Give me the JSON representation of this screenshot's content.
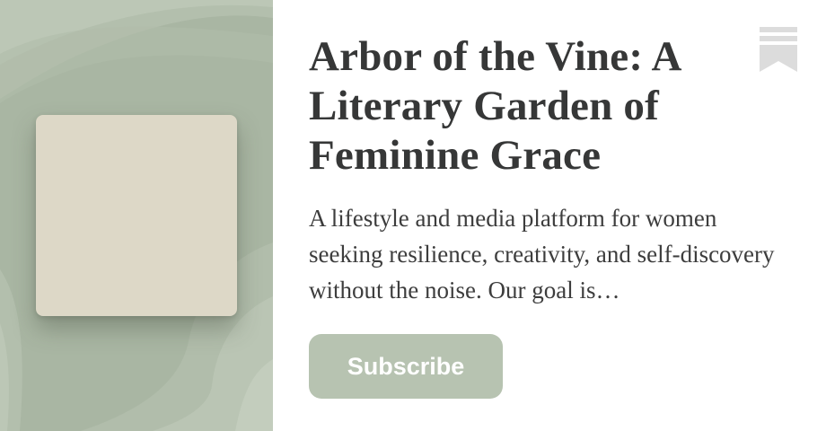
{
  "publication": {
    "title": "Arbor of the Vine: A Literary Garden of Feminine Grace",
    "description": "A lifestyle and media platform for women seeking resilience, creativity, and self-discovery without the noise. Our goal is…"
  },
  "actions": {
    "subscribe_label": "Subscribe"
  },
  "icons": {
    "bookmark": "bookmark-icon"
  },
  "colors": {
    "panel_background": "#a9b6a3",
    "cover": "#ddd8c7",
    "button": "#b7c3b1",
    "title_text": "#363737",
    "bookmark": "#dcdcdc"
  }
}
